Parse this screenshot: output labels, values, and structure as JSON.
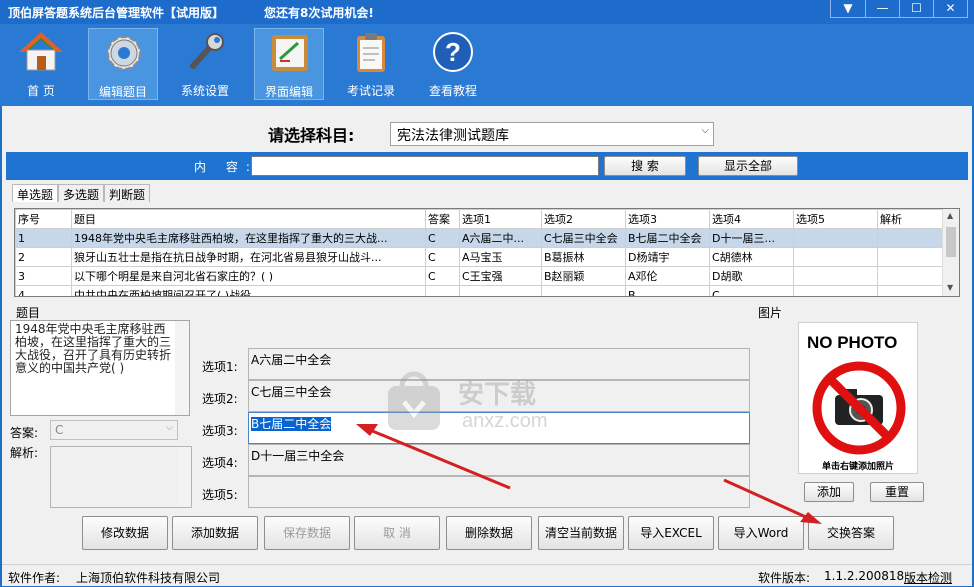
{
  "window": {
    "title": "顶伯屏答题系统后台管理软件【试用版】",
    "trial_notice": "您还有8次试用机会!",
    "buttons": [
      "▼",
      "—",
      "☐",
      "✕"
    ]
  },
  "toolbar": {
    "items": [
      {
        "label": "首  页",
        "icon": "home-icon",
        "active": false
      },
      {
        "label": "编辑题目",
        "icon": "gear-icon",
        "active": true
      },
      {
        "label": "系统设置",
        "icon": "wrench-icon",
        "active": false
      },
      {
        "label": "界面编辑",
        "icon": "edit-board-icon",
        "active": true
      },
      {
        "label": "考试记录",
        "icon": "clipboard-icon",
        "active": false
      },
      {
        "label": "查看教程",
        "icon": "help-icon",
        "active": false
      }
    ]
  },
  "subject": {
    "label": "请选择科目:",
    "selected": "宪法法律测试题库"
  },
  "search": {
    "label": "内 容:",
    "value": "",
    "search_button": "搜  索",
    "show_all_button": "显示全部"
  },
  "tabs": [
    {
      "label": "单选题",
      "active": true
    },
    {
      "label": "多选题",
      "active": false
    },
    {
      "label": "判断题",
      "active": false
    }
  ],
  "grid": {
    "columns": [
      "序号",
      "题目",
      "答案",
      "选项1",
      "选项2",
      "选项3",
      "选项4",
      "选项5",
      "解析"
    ],
    "rows": [
      [
        "1",
        "1948年党中央毛主席移驻西柏坡，在这里指挥了重大的三大战...",
        "C",
        "A六届二中...",
        "C七届三中全会",
        "B七届二中全会",
        "D十一届三...",
        "",
        ""
      ],
      [
        "2",
        "狼牙山五壮士是指在抗日战争时期，在河北省易县狼牙山战斗...",
        "C",
        "A马宝玉",
        "B葛振林",
        "D杨靖宇",
        "C胡德林",
        "",
        ""
      ],
      [
        "3",
        "以下哪个明星是来自河北省石家庄的？(    )",
        "C",
        "C王宝强",
        "B赵丽颖",
        "A邓伦",
        "D胡歌",
        "",
        ""
      ],
      [
        "4",
        "中共中央在西柏坡期间召开了(    )战役",
        "",
        "",
        "",
        "B...",
        "C...",
        "",
        ""
      ]
    ]
  },
  "question_panel": {
    "group_label": "题目",
    "text": "1948年党中央毛主席移驻西柏坡，在这里指挥了重大的三大战役，召开了具有历史转折意义的中国共产党(    )",
    "answer_label": "答案:",
    "answer_value": "C",
    "analysis_label": "解析:",
    "analysis_value": ""
  },
  "options": [
    {
      "label": "选项1:",
      "value": "A六届二中全会"
    },
    {
      "label": "选项2:",
      "value": "C七届三中全会"
    },
    {
      "label": "选项3:",
      "value": "B七届二中全会"
    },
    {
      "label": "选项4:",
      "value": "D十一届三中全会"
    },
    {
      "label": "选项5:",
      "value": ""
    }
  ],
  "photo": {
    "group_label": "图片",
    "placeholder_text": "NO PHOTO",
    "caption": "单击右键添加照片",
    "add_button": "添加",
    "reset_button": "重置"
  },
  "actions": {
    "modify": "修改数据",
    "add": "添加数据",
    "save": "保存数据",
    "cancel": "取  消",
    "delete": "删除数据",
    "clear": "清空当前数据",
    "import_excel": "导入EXCEL",
    "import_word": "导入Word",
    "swap_answer": "交换答案"
  },
  "status_bar": {
    "author_label": "软件作者:",
    "author": "上海顶伯软件科技有限公司",
    "version_label": "软件版本:",
    "version": "1.1.2.200818",
    "check_link": "版本检测"
  },
  "watermark": {
    "text": "安下载",
    "sub": "anxz.com"
  },
  "colors": {
    "titlebar": "#1d6ccc",
    "toolbar": "#2a7ad4",
    "searchbar": "#1f74d2",
    "selection": "#c6d7ea",
    "arrow": "#d32020"
  }
}
